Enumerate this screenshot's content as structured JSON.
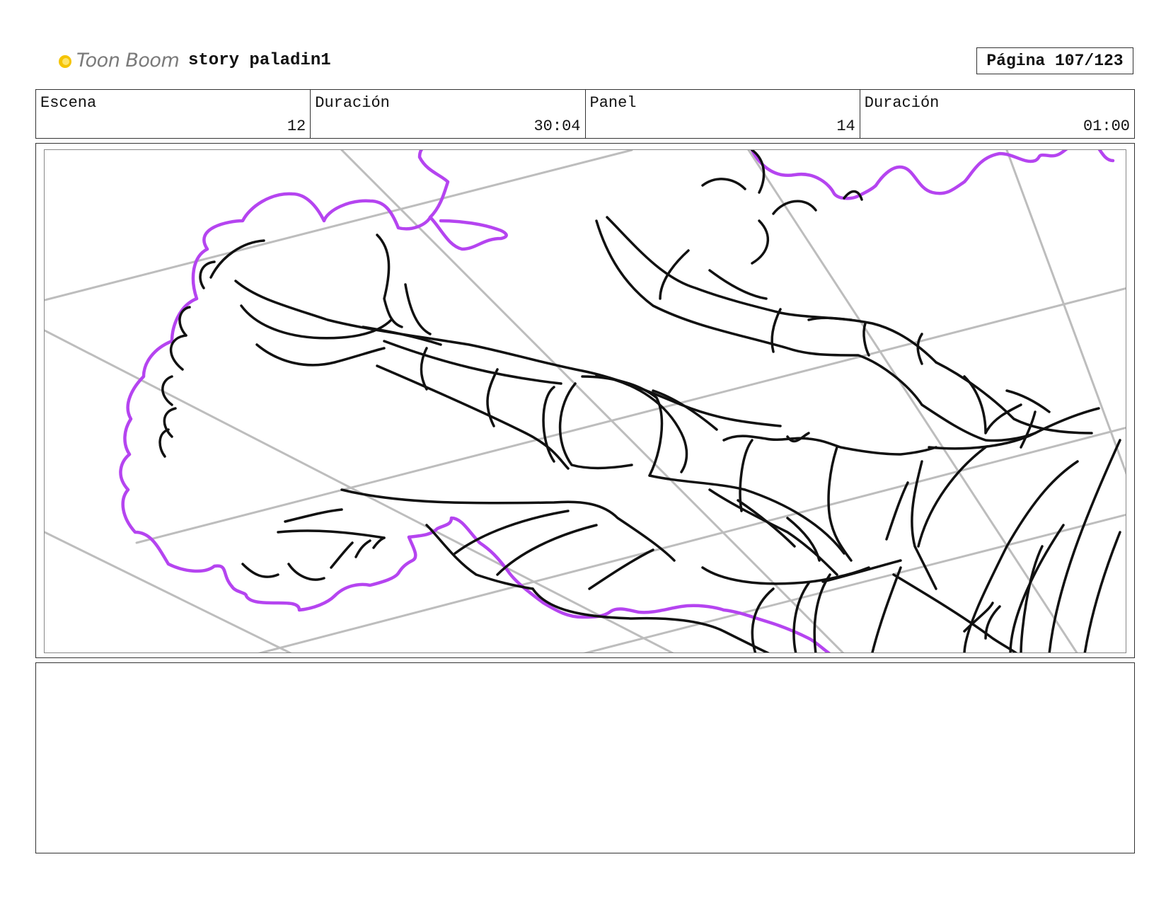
{
  "header": {
    "brand_name": "Toon Boom",
    "project_title": "story paladin1",
    "page_indicator": "Página 107/123"
  },
  "info": {
    "scene_label": "Escena",
    "scene_value": "12",
    "scene_duration_label": "Duración",
    "scene_duration_value": "30:04",
    "panel_label": "Panel",
    "panel_value": "14",
    "panel_duration_label": "Duración",
    "panel_duration_value": "01:00"
  },
  "notes": {
    "text": ""
  },
  "colors": {
    "sketch_line": "#111111",
    "cloud_outline": "#b544f0",
    "guide_line": "#bdbdbd",
    "logo_yellow": "#f5c400",
    "logo_text": "#7a7a7a"
  }
}
